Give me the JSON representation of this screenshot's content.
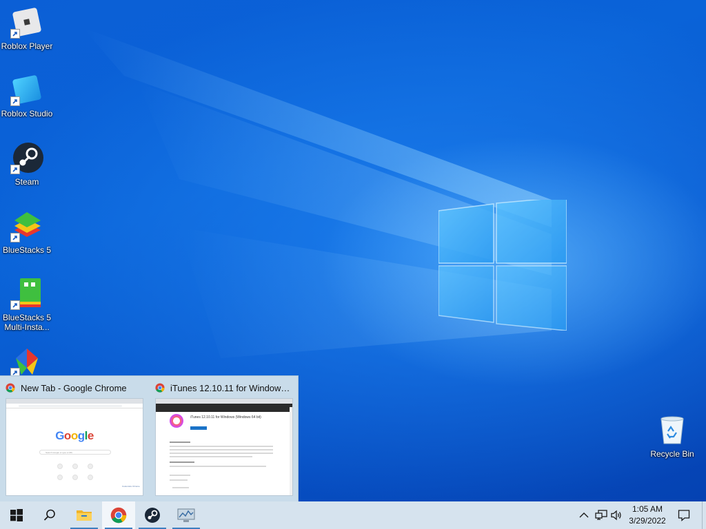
{
  "desktop": {
    "icons": [
      {
        "label": "Roblox Player",
        "icon": "roblox-player-icon"
      },
      {
        "label": "Roblox Studio",
        "icon": "roblox-studio-icon"
      },
      {
        "label": "Steam",
        "icon": "steam-icon"
      },
      {
        "label": "BlueStacks 5",
        "icon": "bluestacks-icon"
      },
      {
        "label": "BlueStacks 5 Multi-Insta...",
        "icon": "bluestacks-multi-instance-icon"
      },
      {
        "label": "",
        "icon": "unnamed-app-icon"
      },
      {
        "label": "Recycle Bin",
        "icon": "recycle-bin-icon"
      }
    ]
  },
  "thumbnails": [
    {
      "title": "New Tab - Google Chrome",
      "preview": {
        "logo": "Google",
        "search_placeholder": "Search Google or type a URL",
        "corner_label": "Customize Chrome"
      }
    },
    {
      "title": "iTunes 12.10.11 for Windows (W...",
      "preview": {
        "heading": "iTunes 12.10.11 for Windows (Windows 64 bit)"
      }
    }
  ],
  "taskbar": {
    "buttons": [
      {
        "name": "start-button",
        "icon": "windows-logo-icon"
      },
      {
        "name": "search-button",
        "icon": "search-icon"
      },
      {
        "name": "file-explorer-button",
        "icon": "folder-icon"
      },
      {
        "name": "chrome-button",
        "icon": "chrome-icon"
      },
      {
        "name": "steam-button",
        "icon": "steam-icon"
      },
      {
        "name": "resource-monitor-button",
        "icon": "monitor-icon"
      }
    ],
    "tray": {
      "time": "1:05 AM",
      "date": "3/29/2022",
      "icons": [
        "chevron-up-icon",
        "network-icon",
        "volume-icon",
        "notification-icon"
      ]
    }
  },
  "colors": {
    "wallpaper_blue": "#0a63d8",
    "taskbar": "#d6e3ee",
    "accent": "#3d7ebf"
  }
}
